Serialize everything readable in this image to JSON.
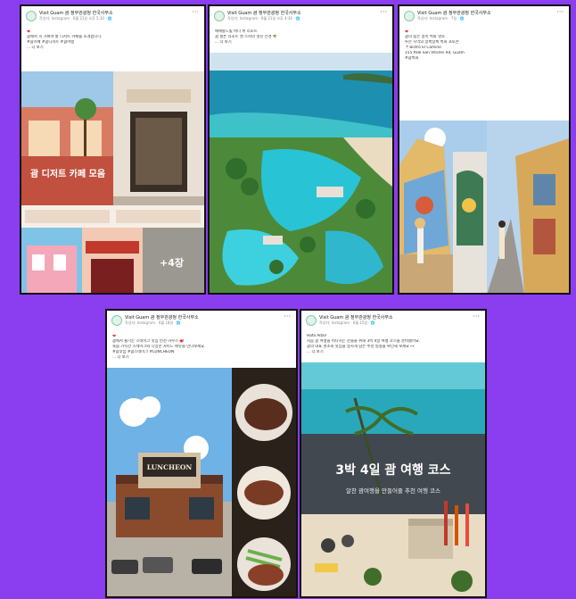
{
  "page": {
    "background": "#8b3df0"
  },
  "posts": [
    {
      "author": "Visit Guam 괌 정부관광청 한국사무소",
      "meta": "작성자: Instagram · 6월 21일 오후 5:10 · 🌐",
      "body": [
        "괌 디저트 카페 모음",
        "괌에서 꼭 가봐야 할 디저트 카페를 소개합니다.",
        "#괌카페 #괌디저트 #괌여행",
        "... 더 보기"
      ],
      "media_title": "괌 디저트 카페 모음",
      "plus_label": "+4장"
    },
    {
      "author": "Visit Guam 괌 정부관광청 한국사무소",
      "meta": "작성자: Instagram · 6월 21일 오후 4:30 · 🌐",
      "body": [
        "에메랄드빛 바다 위 리조트",
        "괌 힐튼 리조트 앤 스파의 멋진 전경 🌴",
        "... 더 보기"
      ]
    },
    {
      "author": "Visit Guam 괌 정부관광청 한국사무소",
      "meta": "작성자: Instagram · 7일 · 🌐",
      "body": [
        "괌의 숨은 골목 벽화 명소",
        "투몬 지역의 알록달록 벽화 포토존",
        "📍Bistro El Camino",
        "155 Pale San Vitores Rd, Guam",
        "#괌벽화"
      ]
    },
    {
      "author": "Visit Guam 괌 정부관광청 한국사무소",
      "meta": "작성자: Instagram · 6월 18일 · 🌐",
      "body": [
        "괌에서 즐기는 스테이크 맛집 런천 하우스 🥩",
        "육즙 가득한 스테이크와 다양한 사이드 메뉴를 만나보세요.",
        "#괌맛집 #괌스테이크 #LUNCHEON",
        "... 더 보기"
      ],
      "sign": "LUNCHEON"
    },
    {
      "author": "Visit Guam 괌 정부관광청 한국사무소",
      "meta": "작성자: Instagram · 6월 15일 · 🌐",
      "body": [
        "Hafa Adai!",
        "처음 괌 여행을 떠나시는 분들을 위해 3박 4일 여행 코스를 준비했어요.",
        "괌의 대표 명소와 맛집을 알차게 담은 추천 일정을 확인해 보세요 👀",
        "... 더 보기"
      ],
      "media_title": "3박 4일 괌 여행 코스",
      "media_sub": "알찬 괌여행을 만들어줄 추천 여행 코스"
    }
  ]
}
